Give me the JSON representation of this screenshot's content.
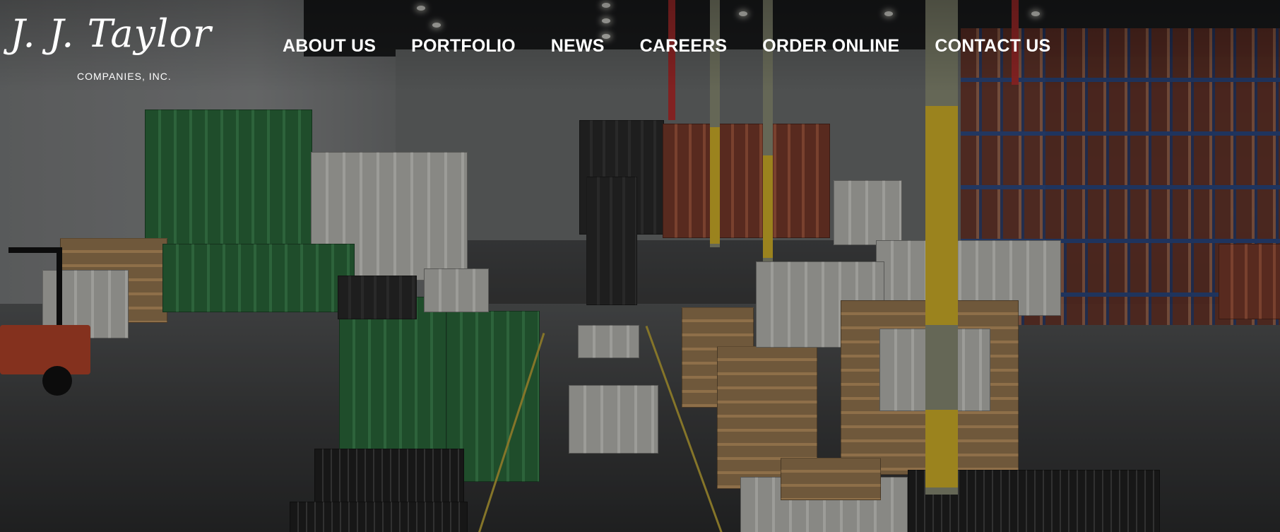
{
  "brand": {
    "logo_script": "J. J. Taylor",
    "logo_subtitle": "COMPANIES, INC."
  },
  "nav": {
    "items": [
      {
        "label": "ABOUT US"
      },
      {
        "label": "PORTFOLIO"
      },
      {
        "label": "NEWS"
      },
      {
        "label": "CAREERS"
      },
      {
        "label": "ORDER ONLINE"
      },
      {
        "label": "CONTACT US"
      }
    ]
  },
  "hero": {
    "background": "warehouse-interior-photo",
    "overlay_color": "#000000"
  }
}
